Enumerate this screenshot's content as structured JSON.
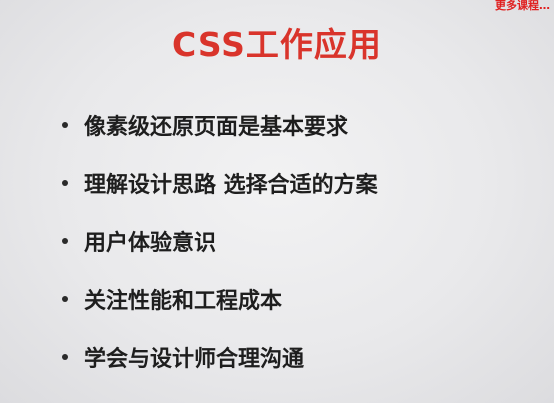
{
  "watermark": "更多课程…",
  "title": "CSS工作应用",
  "bullets": [
    {
      "text": "像素级还原页面是基本要求"
    },
    {
      "text": "理解设计思路 选择合适的方案"
    },
    {
      "text": "用户体验意识"
    },
    {
      "text": "关注性能和工程成本"
    },
    {
      "text": "学会与设计师合理沟通"
    }
  ],
  "colors": {
    "title": "#d9342b",
    "text": "#1e1e1e",
    "background": "#ebebec",
    "watermark": "#e02020"
  }
}
